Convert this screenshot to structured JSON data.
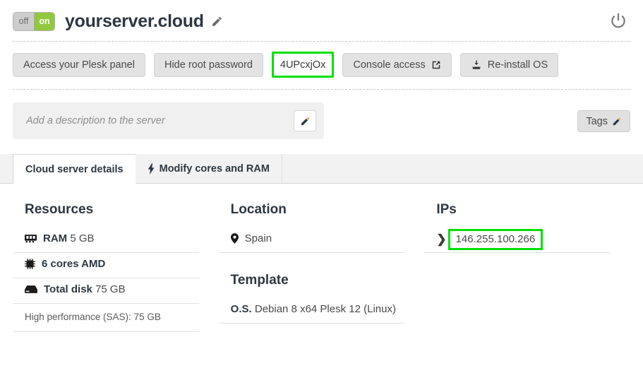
{
  "header": {
    "power_toggle": {
      "off_label": "off",
      "on_label": "on",
      "state": "on"
    },
    "server_name": "yourserver.cloud",
    "edit_name_icon": "pencil-icon",
    "power_icon": "power-icon"
  },
  "actions": [
    {
      "label": "Access your Plesk panel",
      "icon": null,
      "highlighted": false
    },
    {
      "label": "Hide root password",
      "icon": null,
      "highlighted": false
    },
    {
      "label": "4UPcxjOx",
      "icon": null,
      "highlighted": true
    },
    {
      "label": "Console access",
      "icon": "external-link-icon",
      "highlighted": false
    },
    {
      "label": "Re-install OS",
      "icon": "install-os-icon",
      "highlighted": false
    }
  ],
  "description": {
    "placeholder": "Add a description to the server",
    "value": "",
    "edit_icon": "pencil-icon"
  },
  "tags": {
    "label": "Tags",
    "icon": "pencil-icon"
  },
  "tabs": [
    {
      "label": "Cloud server details",
      "icon": null,
      "active": true
    },
    {
      "label": "Modify cores and RAM",
      "icon": "bolt-icon",
      "active": false
    }
  ],
  "resources": {
    "heading": "Resources",
    "ram": {
      "icon": "ram-icon",
      "label": "RAM",
      "value": "5 GB"
    },
    "cpu": {
      "icon": "cpu-icon",
      "label": "6 cores AMD"
    },
    "disk": {
      "icon": "disk-icon",
      "label": "Total disk",
      "value": "75 GB"
    },
    "disk_detail": "High performance (SAS): 75 GB"
  },
  "location": {
    "heading": "Location",
    "icon": "map-pin-icon",
    "value": "Spain"
  },
  "template": {
    "heading": "Template",
    "os_label": "O.S.",
    "os_value": "Debian 8 x64 Plesk 12 (Linux)"
  },
  "ips": {
    "heading": "IPs",
    "expand_icon": "chevron-right-icon",
    "address": "146.255.100.266",
    "highlighted": true
  },
  "colors": {
    "accent_green": "#92c83e",
    "annotation_green": "#00e000",
    "button_gray": "#e3e3e3",
    "title_dark": "#2e3740"
  }
}
